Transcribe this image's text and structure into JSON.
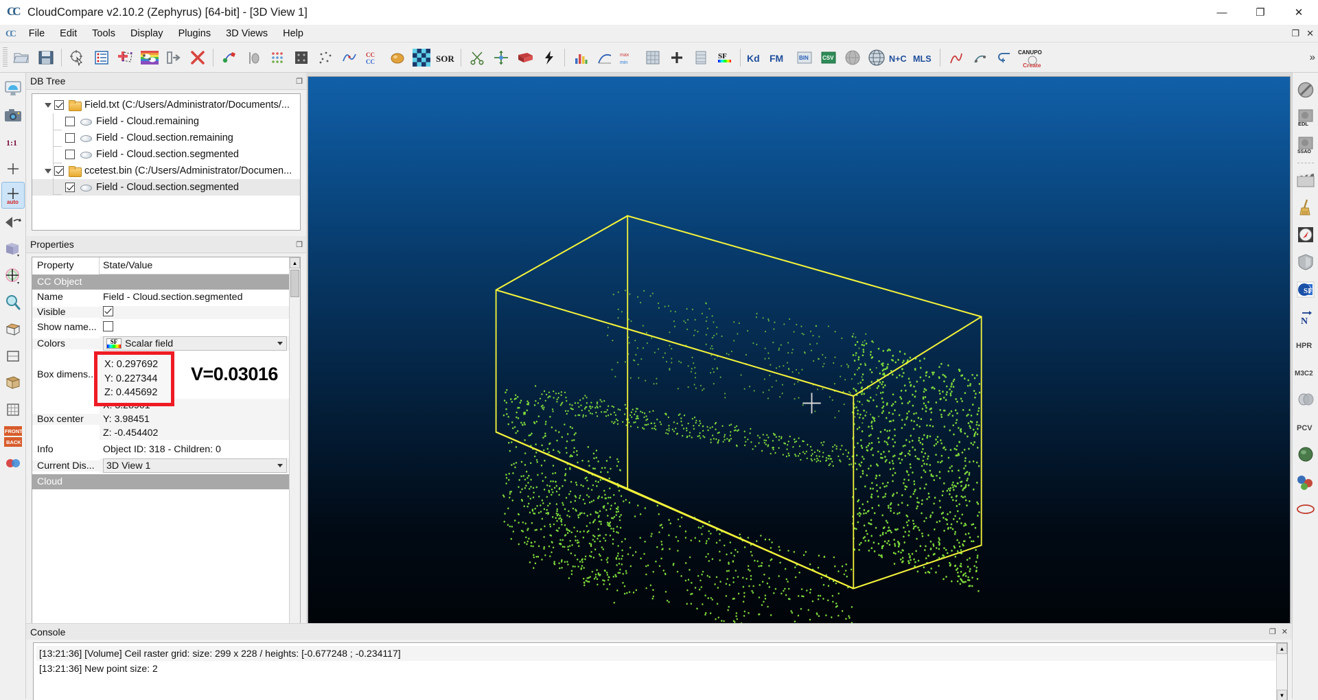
{
  "window": {
    "title": "CloudCompare v2.10.2 (Zephyrus) [64-bit] - [3D View 1]",
    "logo_text": "CC",
    "minimize": "—",
    "maximize": "❐",
    "close": "✕",
    "inner_restore": "❐",
    "inner_close": "✕"
  },
  "menu": {
    "items": [
      {
        "label": "File"
      },
      {
        "label": "Edit"
      },
      {
        "label": "Tools"
      },
      {
        "label": "Display"
      },
      {
        "label": "Plugins"
      },
      {
        "label": "3D Views"
      },
      {
        "label": "Help"
      }
    ]
  },
  "toolbar": {
    "overflow": "»",
    "buttons": [
      {
        "name": "open-file",
        "icon": "folder-open-icon"
      },
      {
        "name": "save-file",
        "icon": "save-icon"
      },
      {
        "name": "pick-point",
        "icon": "point-picking-icon"
      },
      {
        "name": "properties-list",
        "icon": "list-icon"
      },
      {
        "name": "add-point-pair",
        "icon": "register-icon"
      },
      {
        "name": "color-scale",
        "icon": "rainbow-sheep-icon"
      },
      {
        "name": "segment-import",
        "icon": "import-icon"
      },
      {
        "name": "delete",
        "icon": "delete-x-icon"
      },
      {
        "name": "align-clouds",
        "icon": "align-icon"
      },
      {
        "name": "interpolate",
        "icon": "interpolate-icon"
      },
      {
        "name": "subsample",
        "icon": "subsample-icon"
      },
      {
        "name": "compute-normals",
        "icon": "normals-icon"
      },
      {
        "name": "noise-filter",
        "icon": "noise-filter-icon"
      },
      {
        "name": "statistical-test",
        "icon": "stat-test-icon"
      },
      {
        "name": "cc-label",
        "icon": "cc-icon"
      },
      {
        "name": "render-sphere",
        "icon": "sphere-icon"
      },
      {
        "name": "checkerboard",
        "icon": "checkerboard-icon"
      },
      {
        "name": "sor-filter",
        "icon": "sor-icon"
      },
      {
        "name": "scissors",
        "icon": "scissors-icon"
      },
      {
        "name": "translate-rotate",
        "icon": "move-icon"
      },
      {
        "name": "box-section",
        "icon": "red-box-icon"
      },
      {
        "name": "lightning",
        "icon": "lightning-icon"
      },
      {
        "name": "histogram",
        "icon": "histogram-icon"
      },
      {
        "name": "curve-plot",
        "icon": "curve-icon"
      },
      {
        "name": "gradient-min-max",
        "icon": "minmax-icon"
      },
      {
        "name": "raster-tool",
        "icon": "raster-icon"
      },
      {
        "name": "add-plus",
        "icon": "plus-icon"
      },
      {
        "name": "grid-tool",
        "icon": "grid-icon"
      },
      {
        "name": "sf-tool",
        "icon": "sf-icon"
      },
      {
        "name": "kd-tree",
        "icon": "kd-icon",
        "label": "Kd"
      },
      {
        "name": "fast-marching",
        "icon": "fm-icon",
        "label": "FM"
      },
      {
        "name": "bin-export",
        "icon": "bin-icon"
      },
      {
        "name": "csv-export",
        "icon": "csv-icon"
      },
      {
        "name": "global-shift",
        "icon": "globe-gray-icon"
      },
      {
        "name": "geo-globe",
        "icon": "globe-icon"
      },
      {
        "name": "normals-compute",
        "icon": "nc-icon",
        "label": "N+C"
      },
      {
        "name": "mls-smooth",
        "icon": "mls-icon",
        "label": "MLS"
      },
      {
        "name": "hough-normals",
        "icon": "hough-icon"
      },
      {
        "name": "qanimation",
        "icon": "anim-icon"
      },
      {
        "name": "return-arrow",
        "icon": "return-icon"
      },
      {
        "name": "canupo-create",
        "icon": "canupo-icon",
        "label": "CANUPO",
        "sublabel": "Create"
      }
    ]
  },
  "left_toolbar": {
    "buttons": [
      {
        "name": "display-settings",
        "icon": "monitor-icon"
      },
      {
        "name": "snapshot",
        "icon": "camera-icon"
      },
      {
        "name": "zoom-one-to-one",
        "icon": "one-to-one-icon",
        "label": "1:1"
      },
      {
        "name": "pivot-center",
        "icon": "crosshair-icon"
      },
      {
        "name": "auto-pivot",
        "icon": "crosshair-auto-icon",
        "label": "auto",
        "active": true
      },
      {
        "name": "viewport-rotate",
        "icon": "rotate-view-icon"
      },
      {
        "name": "default-views-cube",
        "icon": "cube-icon"
      },
      {
        "name": "translate-tool",
        "icon": "translate-icon"
      },
      {
        "name": "zoom-tool",
        "icon": "magnifier-icon"
      },
      {
        "name": "bounding-box",
        "icon": "bbox-icon"
      },
      {
        "name": "orthographic",
        "icon": "ortho-icon"
      },
      {
        "name": "perspective",
        "icon": "persp-icon"
      },
      {
        "name": "viewport-grid",
        "icon": "viewgrid-icon"
      },
      {
        "name": "front-back-view",
        "icon": "front-back-icon",
        "label_top": "FRONT",
        "label_bottom": "BACK"
      },
      {
        "name": "stereo-mode",
        "icon": "stereo-icon"
      }
    ]
  },
  "right_toolbar": {
    "buttons": [
      {
        "name": "no-filter",
        "icon": "no-entry-icon"
      },
      {
        "name": "edl-shader",
        "icon": "edl-icon",
        "label": "EDL"
      },
      {
        "name": "ssao-shader",
        "icon": "ssao-icon",
        "label": "SSAO"
      },
      {
        "name": "animation-clapper",
        "icon": "clapper-icon"
      },
      {
        "name": "broom-cleaner",
        "icon": "broom-icon"
      },
      {
        "name": "compass",
        "icon": "compass-icon"
      },
      {
        "name": "shield-facets",
        "icon": "shield-icon"
      },
      {
        "name": "sf-plugin",
        "icon": "sf-blue-icon",
        "label": "SF"
      },
      {
        "name": "north-arrow",
        "icon": "north-icon",
        "label": "N"
      },
      {
        "name": "hpr-filter",
        "icon": "hpr-icon",
        "label": "HPR"
      },
      {
        "name": "m3c2-plugin",
        "icon": "m3c2-icon",
        "label": "M3C2"
      },
      {
        "name": "cork-boolean",
        "icon": "cork-icon"
      },
      {
        "name": "pcv-shader",
        "icon": "pcv-icon",
        "label": "PCV"
      },
      {
        "name": "poisson-recon",
        "icon": "poisson-icon"
      },
      {
        "name": "ransac-shapes",
        "icon": "ransac-icon"
      },
      {
        "name": "qhull-hull",
        "icon": "hull-icon"
      }
    ]
  },
  "db_tree": {
    "title": "DB Tree",
    "float_icon": "❐",
    "nodes": [
      {
        "label": "Field.txt (C:/Users/Administrator/Documents/...",
        "type": "folder",
        "checked": true,
        "expanded": true,
        "level": 0,
        "selected": false
      },
      {
        "label": "Field - Cloud.remaining",
        "type": "cloud",
        "checked": false,
        "level": 1,
        "selected": false
      },
      {
        "label": "Field - Cloud.section.remaining",
        "type": "cloud",
        "checked": false,
        "level": 1,
        "selected": false
      },
      {
        "label": "Field - Cloud.section.segmented",
        "type": "cloud",
        "checked": false,
        "level": 1,
        "selected": false
      },
      {
        "label": "ccetest.bin (C:/Users/Administrator/Documen...",
        "type": "folder",
        "checked": true,
        "expanded": true,
        "level": 0,
        "selected": false
      },
      {
        "label": "Field - Cloud.section.segmented",
        "type": "cloud",
        "checked": true,
        "level": 1,
        "selected": true
      }
    ]
  },
  "properties": {
    "title": "Properties",
    "float_icon": "❐",
    "col_property": "Property",
    "col_state": "State/Value",
    "section_cc_object": "CC Object",
    "section_cloud": "Cloud",
    "rows": [
      {
        "key": "Name",
        "value": "Field - Cloud.section.segmented",
        "type": "text"
      },
      {
        "key": "Visible",
        "value": "",
        "type": "checkbox",
        "checked": true
      },
      {
        "key": "Show name...",
        "value": "",
        "type": "checkbox",
        "checked": false
      },
      {
        "key": "Colors",
        "value": "Scalar field",
        "type": "combo-sf"
      },
      {
        "key": "Box dimens..",
        "value": "",
        "type": "xyz"
      },
      {
        "key": "Box center",
        "value": "",
        "type": "xyz2"
      },
      {
        "key": "Info",
        "value": "Object ID: 318 - Children: 0",
        "type": "text"
      },
      {
        "key": "Current Dis...",
        "value": "3D View 1",
        "type": "combo"
      }
    ],
    "box_dimensions": {
      "x": "X: 0.297692",
      "y": "Y: 0.227344",
      "z": "Z: 0.445692"
    },
    "box_center": {
      "x": "X: 3.28901",
      "y": "Y: 3.98451",
      "z": "Z: -0.454402"
    }
  },
  "annotation": {
    "volume_label": "V=0.03016",
    "highlight_color": "#ee1b24"
  },
  "viewport": {
    "scale_value": "0.35",
    "axis_x_color": "#ff1a1a",
    "axis_y_color": "#19e019",
    "axis_z_color": "#2196f3"
  },
  "console": {
    "title": "Console",
    "float_icon": "❐",
    "close_icon": "✕",
    "lines": [
      "[13:21:36] [Volume] Ceil raster grid: size: 299 x 228 / heights: [-0.677248 ; -0.234117]",
      "[13:21:36] New point size: 2"
    ]
  }
}
